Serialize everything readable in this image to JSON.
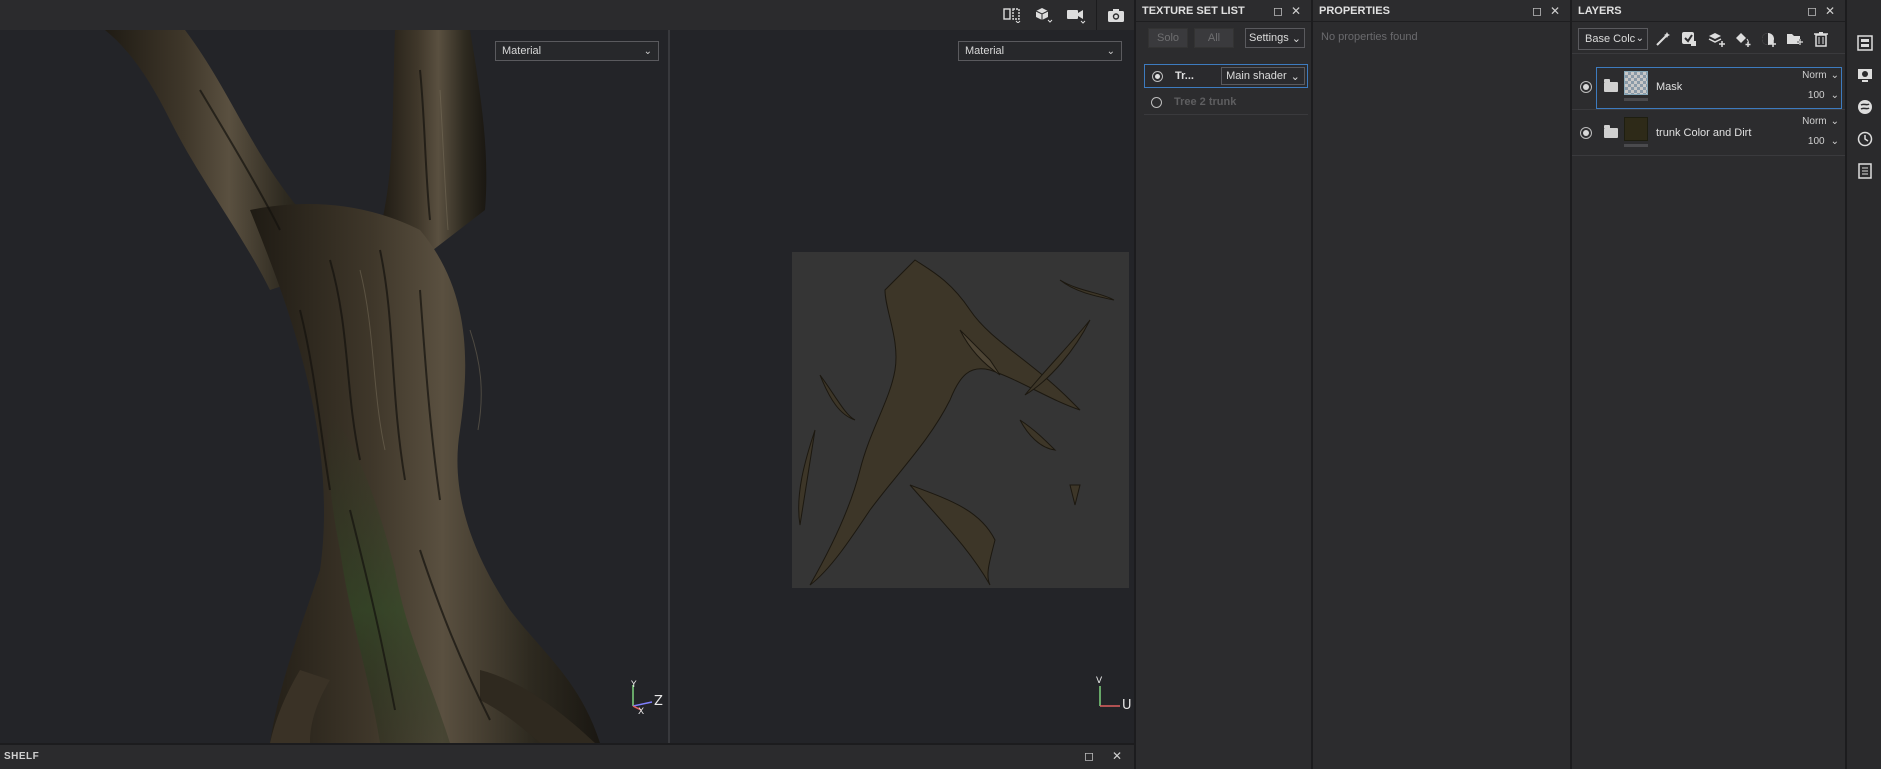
{
  "viewport": {
    "material_left": "Material",
    "material_right": "Material",
    "axis_3d_y": "Y",
    "axis_3d_x": "X",
    "axis_3d_z": "Z",
    "axis_2d_v": "V",
    "axis_2d_u": "U",
    "toolbar_icons": [
      "split-view-icon",
      "cube-icon",
      "camera-video-icon",
      "screenshot-icon"
    ]
  },
  "bottom_panel": {
    "title": "SHELF"
  },
  "texture_set_list": {
    "title": "TEXTURE SET LIST",
    "solo_label": "Solo",
    "all_label": "All",
    "settings_label": "Settings",
    "sets": [
      {
        "name": "Tr...",
        "shader": "Main shader",
        "active": true
      },
      {
        "name": "Tree 2 trunk",
        "active": false
      }
    ]
  },
  "properties": {
    "title": "PROPERTIES",
    "empty_text": "No properties found"
  },
  "layers": {
    "title": "LAYERS",
    "channel": "Base Colc",
    "items": [
      {
        "name": "Mask",
        "blend": "Norm",
        "opacity": "100",
        "selected": true
      },
      {
        "name": "trunk Color and Dirt",
        "blend": "Norm",
        "opacity": "100",
        "selected": false
      }
    ]
  },
  "colors": {
    "accent": "#3d7bbf",
    "panel_bg": "#2c2c2e",
    "viewport_bg": "#232428"
  }
}
